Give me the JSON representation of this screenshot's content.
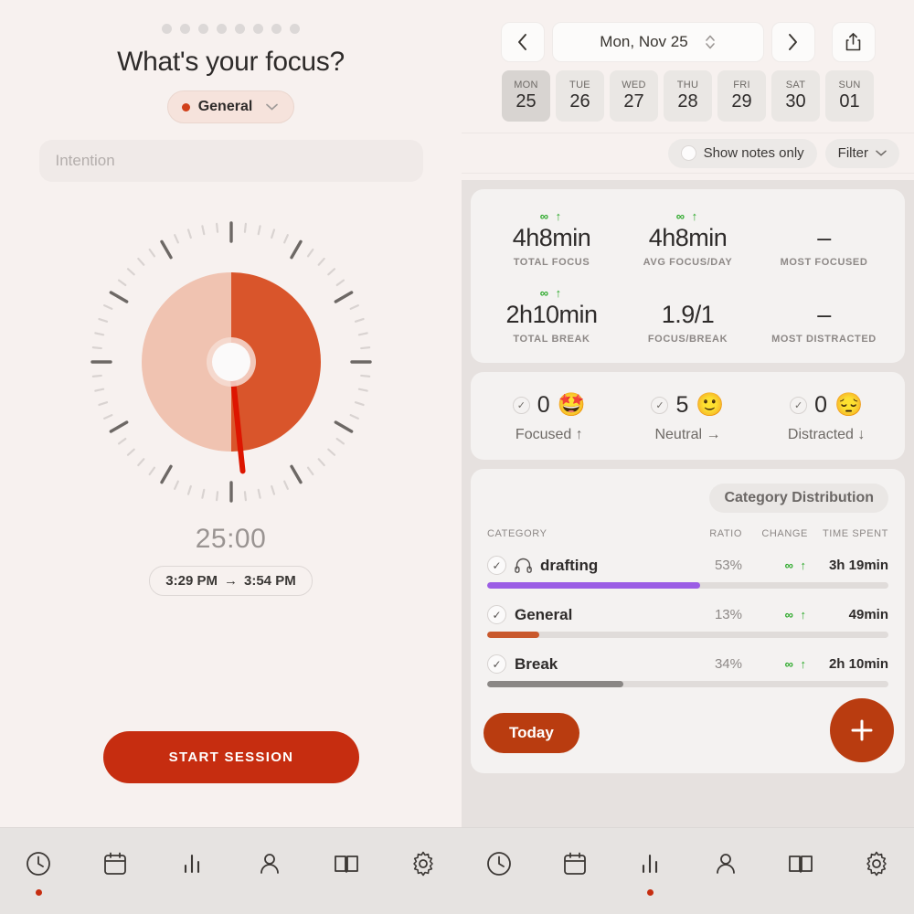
{
  "left": {
    "page_dots": 8,
    "title": "What's your focus?",
    "category_chip": {
      "label": "General",
      "color": "#d1401a",
      "chevron": "chevron-down"
    },
    "intention": {
      "value": "",
      "placeholder": "Intention"
    },
    "clock": {
      "filled_fraction": 0.5,
      "hand_angle_deg": 174,
      "dial_light": "#f0c3b1",
      "dial_dark": "#d9552b",
      "hand_color": "#dd1500"
    },
    "timer_readout": "25:00",
    "time_range": {
      "start": "3:29 PM",
      "arrow": "→",
      "end": "3:54 PM"
    },
    "start_button": "START SESSION"
  },
  "right": {
    "header": {
      "prev": "‹",
      "next": "›",
      "date_label": "Mon, Nov 25",
      "stepper": "up-down-chevrons",
      "share": "share-icon"
    },
    "week": [
      {
        "dow": "MON",
        "day": "25",
        "active": true
      },
      {
        "dow": "TUE",
        "day": "26",
        "active": false
      },
      {
        "dow": "WED",
        "day": "27",
        "active": false
      },
      {
        "dow": "THU",
        "day": "28",
        "active": false
      },
      {
        "dow": "FRI",
        "day": "29",
        "active": false
      },
      {
        "dow": "SAT",
        "day": "30",
        "active": false
      },
      {
        "dow": "SUN",
        "day": "01",
        "active": false
      }
    ],
    "filter_bar": {
      "notes_toggle_label": "Show notes only",
      "notes_toggle_on": false,
      "filter_label": "Filter"
    },
    "summary": [
      {
        "change": "∞ ↑",
        "value": "4h8min",
        "caption": "TOTAL FOCUS"
      },
      {
        "change": "∞ ↑",
        "value": "4h8min",
        "caption": "AVG FOCUS/DAY"
      },
      {
        "change": "",
        "value": "–",
        "caption": "MOST FOCUSED"
      },
      {
        "change": "∞ ↑",
        "value": "2h10min",
        "caption": "TOTAL BREAK"
      },
      {
        "change": "",
        "value": "1.9/1",
        "caption": "FOCUS/BREAK"
      },
      {
        "change": "",
        "value": "–",
        "caption": "MOST DISTRACTED"
      }
    ],
    "moods": [
      {
        "count": "0",
        "emoji": "🤩",
        "label": "Focused ↑"
      },
      {
        "count": "5",
        "emoji": "🙂",
        "label": "Neutral →"
      },
      {
        "count": "0",
        "emoji": "😔",
        "label": "Distracted ↓"
      }
    ],
    "category_panel": {
      "title": "Category Distribution",
      "headers": {
        "category": "CATEGORY",
        "ratio": "RATIO",
        "change": "CHANGE",
        "time": "TIME SPENT"
      },
      "today_button": "Today",
      "add_button": "+"
    }
  },
  "chart_data": {
    "type": "bar",
    "title": "Category Distribution",
    "xlabel": "",
    "ylabel": "Ratio (%)",
    "categories": [
      "drafting",
      "General",
      "Break"
    ],
    "values": [
      53,
      13,
      34
    ],
    "ylim": [
      0,
      100
    ],
    "grid": false,
    "legend": "none",
    "series": [
      {
        "name": "Ratio",
        "values": [
          53,
          13,
          34
        ]
      }
    ],
    "rows": [
      {
        "category": "drafting",
        "icon": "headphones-icon",
        "ratio": "53%",
        "ratio_value": 53,
        "change": "∞ ↑",
        "time_spent": "3h 19min",
        "bar_color": "#9b5de5",
        "checked": true
      },
      {
        "category": "General",
        "icon": "",
        "ratio": "13%",
        "ratio_value": 13,
        "change": "∞ ↑",
        "time_spent": "49min",
        "bar_color": "#c9582c",
        "checked": true
      },
      {
        "category": "Break",
        "icon": "",
        "ratio": "34%",
        "ratio_value": 34,
        "change": "∞ ↑",
        "time_spent": "2h 10min",
        "bar_color": "#8a8785",
        "checked": true
      }
    ]
  },
  "nav_left": [
    {
      "icon": "clock-icon",
      "active": true
    },
    {
      "icon": "calendar-icon",
      "active": false
    },
    {
      "icon": "bar-chart-icon",
      "active": false
    },
    {
      "icon": "person-icon",
      "active": false
    },
    {
      "icon": "book-icon",
      "active": false
    },
    {
      "icon": "gear-icon",
      "active": false
    }
  ],
  "nav_right": [
    {
      "icon": "clock-icon",
      "active": false
    },
    {
      "icon": "calendar-icon",
      "active": false
    },
    {
      "icon": "bar-chart-icon",
      "active": true
    },
    {
      "icon": "person-icon",
      "active": false
    },
    {
      "icon": "book-icon",
      "active": false
    },
    {
      "icon": "gear-icon",
      "active": false
    }
  ]
}
